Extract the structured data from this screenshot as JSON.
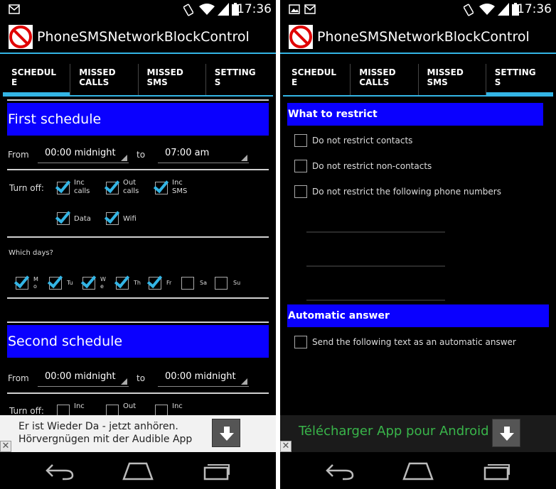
{
  "status_bar": {
    "time": "17:36"
  },
  "app": {
    "title": "PhoneSMSNetworkBlockControl"
  },
  "tabs": [
    {
      "line1": "SCHEDUL",
      "line2": "E"
    },
    {
      "line1": "MISSED",
      "line2": "CALLS"
    },
    {
      "line1": "MISSED",
      "line2": "SMS"
    },
    {
      "line1": "SETTING",
      "line2": "S"
    }
  ],
  "left_screen": {
    "selected_tab": "SCHEDULE",
    "schedules": [
      {
        "title": "First schedule",
        "from_label": "From",
        "from_value": "00:00 midnight",
        "to_label": "to",
        "to_value": "07:00 am",
        "turn_off_label": "Turn off:",
        "options": [
          {
            "line1": "Inc",
            "line2": "calls",
            "checked": true
          },
          {
            "line1": "Out",
            "line2": "calls",
            "checked": true
          },
          {
            "line1": "Inc",
            "line2": "SMS",
            "checked": true
          },
          {
            "line1": "Data",
            "line2": "",
            "checked": true
          },
          {
            "line1": "Wifi",
            "line2": "",
            "checked": true
          }
        ],
        "days_label": "Which days?",
        "days": [
          {
            "line1": "M",
            "line2": "o",
            "checked": true
          },
          {
            "line1": "Tu",
            "line2": "",
            "checked": true
          },
          {
            "line1": "W",
            "line2": "e",
            "checked": true
          },
          {
            "line1": "Th",
            "line2": "",
            "checked": true
          },
          {
            "line1": "Fr",
            "line2": "",
            "checked": true
          },
          {
            "line1": "Sa",
            "line2": "",
            "checked": false
          },
          {
            "line1": "Su",
            "line2": "",
            "checked": false
          }
        ]
      },
      {
        "title": "Second schedule",
        "from_label": "From",
        "from_value": "00:00 midnight",
        "to_label": "to",
        "to_value": "00:00 midnight",
        "turn_off_label": "Turn off:",
        "options_partial": [
          {
            "line1": "Inc",
            "checked": false
          },
          {
            "line1": "Out",
            "checked": false
          },
          {
            "line1": "Inc",
            "checked": false
          }
        ]
      }
    ],
    "ad": {
      "line1": "Er ist Wieder Da - jetzt anhören.",
      "line2": "Hörvergnügen mit der Audible App"
    }
  },
  "right_screen": {
    "selected_tab": "SETTINGS",
    "restrict_header": "What to restrict",
    "restrict_options": [
      {
        "label": "Do not restrict contacts",
        "checked": false
      },
      {
        "label": "Do not restrict non-contacts",
        "checked": false
      },
      {
        "label": "Do not restrict the following phone numbers",
        "checked": false
      }
    ],
    "auto_answer_header": "Automatic answer",
    "auto_answer_option": {
      "label": "Send the following text as an automatic answer",
      "checked": false
    },
    "ad": {
      "text": "Télécharger App pour Android"
    }
  },
  "colors": {
    "header_blue": "#0a00ff",
    "holo_blue": "#33b5e5",
    "ad_green": "#39b54a",
    "background": "#000000"
  },
  "icons": {
    "status_left_left": [
      "image-icon",
      "gmail-icon"
    ],
    "status_left_right": [
      "image-icon",
      "gmail-icon"
    ],
    "status_right": [
      "rotation-icon",
      "wifi-icon",
      "signal-icon",
      "battery-icon"
    ],
    "app": "no-entry-icon",
    "ad": "download-arrow-icon",
    "ad_close": "close-icon",
    "nav": [
      "back-icon",
      "home-icon",
      "recent-apps-icon"
    ]
  }
}
